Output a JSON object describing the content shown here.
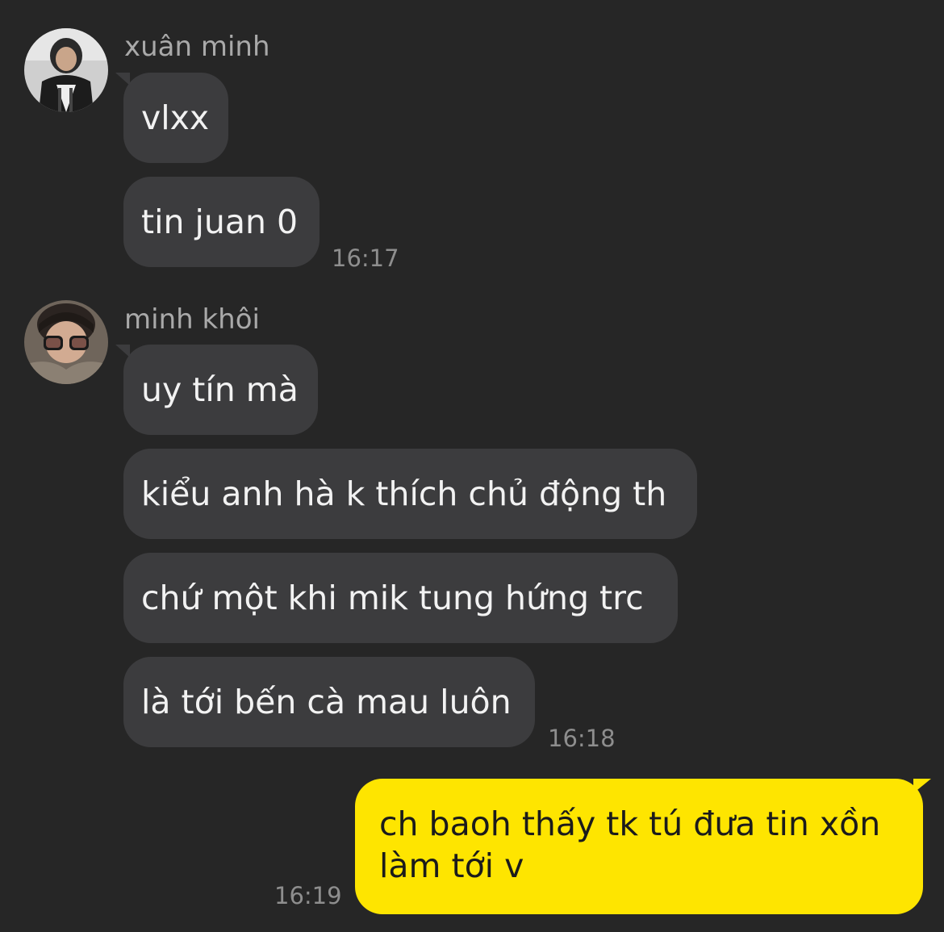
{
  "messages_group_1": {
    "sender": "xuân minh",
    "bubbles": [
      "vlxx",
      "tin juan 0"
    ],
    "time": "16:17"
  },
  "messages_group_2": {
    "sender": "minh khôi",
    "bubbles": [
      "uy tín mà",
      "kiểu anh hà k thích chủ động th",
      "chứ một khi mik tung hứng trc",
      "là tới bến cà mau luôn"
    ],
    "time": "16:18"
  },
  "my_message": {
    "lines": [
      "ch baoh thấy tk tú đưa tin xồn",
      "làm tới v"
    ],
    "time": "16:19"
  },
  "colors": {
    "background": "#262626",
    "incoming_bubble": "#3c3c3e",
    "outgoing_bubble": "#fee500"
  }
}
